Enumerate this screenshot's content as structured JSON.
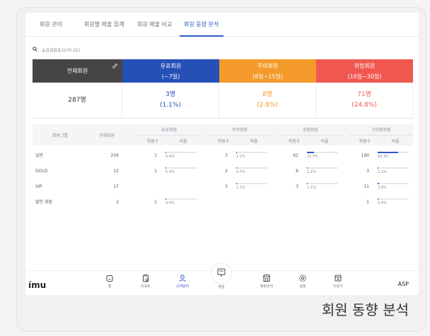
{
  "tabs": [
    {
      "label": "회원 관리",
      "active": false
    },
    {
      "label": "회원별 매출 집계",
      "active": false
    },
    {
      "label": "회원 매출 비교",
      "active": false
    },
    {
      "label": "회원 동향 분석",
      "active": true
    }
  ],
  "filter": {
    "text": "송감회원표시(아니요)",
    "icon": "search-icon"
  },
  "summary": [
    {
      "title": "전체회원",
      "subtitle": "",
      "count": "287명",
      "pct": "",
      "color": "#454545",
      "text_color": "#333333"
    },
    {
      "title": "유효회원",
      "subtitle": "(~7일)",
      "count": "3명",
      "pct": "(1.1%)",
      "color": "#2550b6",
      "text_color": "#2550b6"
    },
    {
      "title": "주의회원",
      "subtitle": "(8일~15일)",
      "count": "8명",
      "pct": "(2.8%)",
      "color": "#f39a2a",
      "text_color": "#f39a2a"
    },
    {
      "title": "위험회원",
      "subtitle": "(16일~30일)",
      "count": "71명",
      "pct": "(24.8%)",
      "color": "#f0584f",
      "text_color": "#f0584f"
    }
  ],
  "table": {
    "col_group": "회원그룹",
    "col_total": "전체회원",
    "groups": [
      "유효회원",
      "주의회원",
      "위험회원",
      "고위험회원"
    ],
    "sub_count": "회원수",
    "sub_ratio": "비율",
    "rows": [
      {
        "name": "일반",
        "total": "256",
        "cells": [
          {
            "n": "1",
            "p": "0.4%",
            "f": 0.004
          },
          {
            "n": "3",
            "p": "1.1%",
            "f": 0.011
          },
          {
            "n": "62",
            "p": "21.7%",
            "f": 0.217
          },
          {
            "n": "190",
            "p": "66.3%",
            "f": 0.663
          }
        ]
      },
      {
        "name": "GOLD",
        "total": "12",
        "cells": [
          {
            "n": "1",
            "p": "0.4%",
            "f": 0.004
          },
          {
            "n": "2",
            "p": "0.7%",
            "f": 0.007
          },
          {
            "n": "6",
            "p": "2.1%",
            "f": 0.021
          },
          {
            "n": "3",
            "p": "1.1%",
            "f": 0.011
          }
        ]
      },
      {
        "name": "VIP",
        "total": "17",
        "cells": [
          null,
          {
            "n": "3",
            "p": "1.1%",
            "f": 0.011
          },
          {
            "n": "3",
            "p": "1.1%",
            "f": 0.011
          },
          {
            "n": "11",
            "p": "3.9%",
            "f": 0.039
          }
        ]
      },
      {
        "name": "할인 회원",
        "total": "2",
        "cells": [
          {
            "n": "1",
            "p": "0.4%",
            "f": 0.004
          },
          null,
          null,
          {
            "n": "1",
            "p": "0.4%",
            "f": 0.004
          }
        ]
      }
    ]
  },
  "nav": {
    "logo": "ímu",
    "items": [
      {
        "label": "홈",
        "icon": "home-icon",
        "active": false
      },
      {
        "label": "리포트",
        "icon": "report-icon",
        "active": false
      },
      {
        "label": "고객관리",
        "icon": "person-icon",
        "active": true
      },
      {
        "label": "영업",
        "icon": "pos-icon",
        "active": false
      },
      {
        "label": "매장관리",
        "icon": "store-icon",
        "active": false
      },
      {
        "label": "설정",
        "icon": "gear-icon",
        "active": false
      },
      {
        "label": "더보기",
        "icon": "more-icon",
        "active": false
      }
    ],
    "right_label": "ASP"
  },
  "caption": "회원 동향 분석"
}
